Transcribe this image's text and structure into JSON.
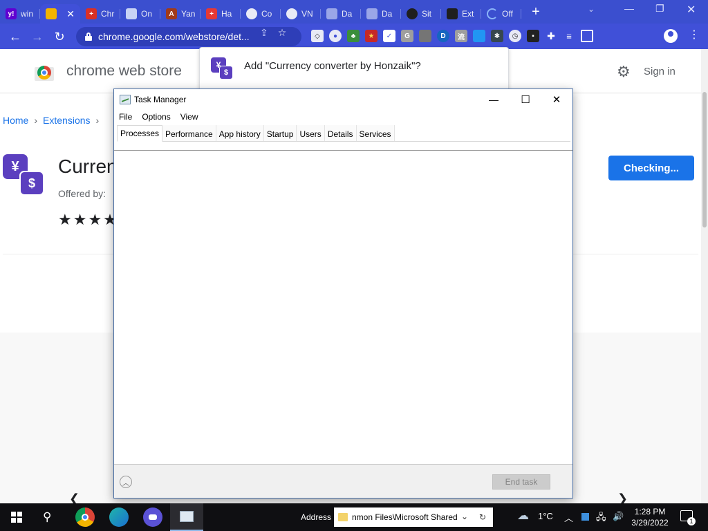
{
  "browser": {
    "tabs": [
      {
        "label": "win",
        "favicon": "yahoo-favicon",
        "color": "#6001d2",
        "glyph": "y!"
      },
      {
        "label": "",
        "favicon": "webstore-favicon",
        "color": "#f4b400",
        "glyph": "",
        "active": true
      },
      {
        "label": "Chr",
        "favicon": "red-app-favicon",
        "color": "#d93025",
        "glyph": "+"
      },
      {
        "label": "On",
        "favicon": "document-favicon",
        "color": "#c8d3f5",
        "glyph": ""
      },
      {
        "label": "Yan",
        "favicon": "brave-favicon",
        "color": "#a13a1a",
        "glyph": "A"
      },
      {
        "label": "Ha",
        "favicon": "swiss-favicon",
        "color": "#e53935",
        "glyph": "+"
      },
      {
        "label": "Co",
        "favicon": "shield-favicon",
        "color": "#e8eaf6",
        "glyph": ""
      },
      {
        "label": "VN",
        "favicon": "shield-favicon",
        "color": "#e8eaf6",
        "glyph": ""
      },
      {
        "label": "Da",
        "favicon": "puzzle-doc-favicon",
        "color": "#9aa6e8",
        "glyph": ""
      },
      {
        "label": "Da",
        "favicon": "puzzle-doc-favicon",
        "color": "#9aa6e8",
        "glyph": ""
      },
      {
        "label": "Sit",
        "favicon": "globe-favicon",
        "color": "#1f1f1f",
        "glyph": ""
      },
      {
        "label": "Ext",
        "favicon": "puzzle-favicon",
        "color": "#1f1f1f",
        "glyph": ""
      },
      {
        "label": "Off",
        "favicon": "loading-favicon",
        "color": "#8ab4f8",
        "glyph": ""
      }
    ],
    "url": "chrome.google.com/webstore/det...",
    "extensions": [
      {
        "name": "ext-diamond-icon",
        "color": "#e8eaf6",
        "glyph": "◇"
      },
      {
        "name": "ext-circle-icon",
        "color": "#e8eaf6",
        "glyph": "●"
      },
      {
        "name": "ext-tree-icon",
        "color": "#3b8e3b",
        "glyph": "♣"
      },
      {
        "name": "ext-flag-icon",
        "color": "#c62828",
        "glyph": "★"
      },
      {
        "name": "ext-check-icon",
        "color": "#ffffff",
        "glyph": "✓"
      },
      {
        "name": "ext-g-icon",
        "color": "#9e9e9e",
        "glyph": "G"
      },
      {
        "name": "ext-square-icon",
        "color": "#757575",
        "glyph": ""
      },
      {
        "name": "ext-d-icon",
        "color": "#1565c0",
        "glyph": "D"
      },
      {
        "name": "ext-chinese-icon",
        "color": "#9e9e9e",
        "glyph": "流"
      },
      {
        "name": "ext-puzzle-blue-icon",
        "color": "#2196f3",
        "glyph": ""
      },
      {
        "name": "ext-bug-icon",
        "color": "#37474f",
        "glyph": "✱"
      },
      {
        "name": "ext-clock-icon",
        "color": "#e8eaf6",
        "glyph": "◷"
      },
      {
        "name": "ext-save-icon",
        "color": "#212121",
        "glyph": "▪"
      }
    ]
  },
  "webstore": {
    "title": "chrome web store",
    "sign_in": "Sign in",
    "breadcrumbs": [
      "Home",
      "Extensions"
    ],
    "extension_name": "Curren",
    "offered_by": "Offered by:",
    "stars": "★★★★",
    "action_button": "Checking..."
  },
  "popup": {
    "text": "Add \"Currency converter by Honzaik\"?"
  },
  "task_manager": {
    "title": "Task Manager",
    "menu": [
      "File",
      "Options",
      "View"
    ],
    "tabs": [
      "Processes",
      "Performance",
      "App history",
      "Startup",
      "Users",
      "Details",
      "Services"
    ],
    "active_tab": "Processes",
    "end_task": "End task"
  },
  "taskbar": {
    "address_label": "Address",
    "address_value": "nmon Files\\Microsoft Shared",
    "temperature": "1°C",
    "time": "1:28 PM",
    "date": "3/29/2022",
    "notification_count": "1"
  }
}
